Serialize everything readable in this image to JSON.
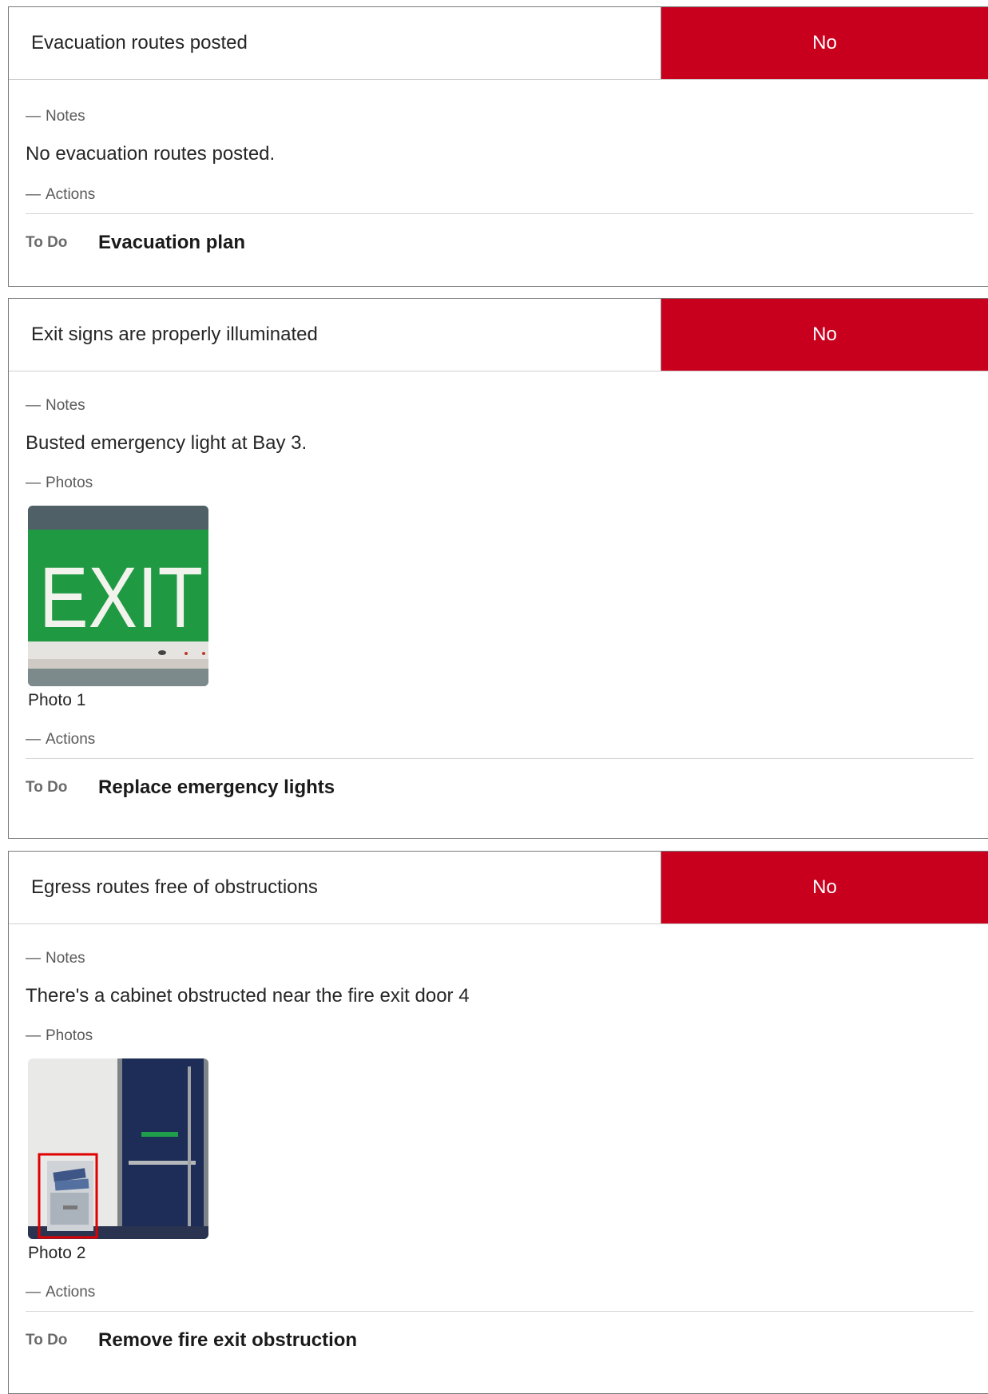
{
  "colors": {
    "answer_no": "#c8001e",
    "border": "#7a7a7a"
  },
  "labels": {
    "notes": "Notes",
    "photos": "Photos",
    "actions": "Actions",
    "dash": "—"
  },
  "items": [
    {
      "question": "Evacuation routes posted",
      "answer": "No",
      "note": "No evacuation routes posted.",
      "action_status": "To Do",
      "action_title": "Evacuation plan"
    },
    {
      "question": "Exit signs are properly illuminated",
      "answer": "No",
      "note": "Busted emergency light at Bay 3.",
      "photo_caption": "Photo 1",
      "photo_text": "EXIT",
      "action_status": "To Do",
      "action_title": "Replace emergency lights"
    },
    {
      "question": "Egress routes free of obstructions",
      "answer": "No",
      "note": "There's a cabinet obstructed near the fire exit door 4",
      "photo_caption": "Photo 2",
      "action_status": "To Do",
      "action_title": "Remove fire exit obstruction"
    }
  ]
}
